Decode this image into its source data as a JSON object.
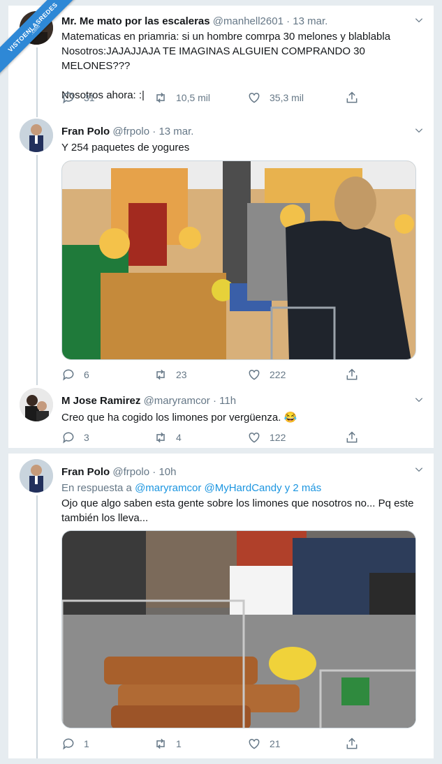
{
  "watermark": {
    "line1": "VISTOENLASREDES",
    "line2": ".com"
  },
  "tweets": [
    {
      "name": "Mr. Me mato por las escaleras",
      "handle": "@manhell2601",
      "dot": "·",
      "time": "13 mar.",
      "text": "Matematicas en priamria: si un hombre comrpa 30 melones y blablabla\nNosotros:JAJAJJAJA TE IMAGINAS ALGUIEN COMPRANDO 30 MELONES???\n\nNosotros ahora:  :|",
      "replies": "31",
      "retweets": "10,5 mil",
      "likes": "35,3 mil"
    },
    {
      "name": "Fran Polo",
      "handle": "@frpolo",
      "dot": "·",
      "time": "13 mar.",
      "text": "Y 254 paquetes de yogures",
      "replies": "6",
      "retweets": "23",
      "likes": "222"
    },
    {
      "name": "M Jose Ramirez",
      "handle": "@maryramcor",
      "dot": "·",
      "time": "11h",
      "text": "Creo que ha cogido los limones por vergüenza. 😂",
      "replies": "3",
      "retweets": "4",
      "likes": "122"
    },
    {
      "name": "Fran Polo",
      "handle": "@frpolo",
      "dot": "·",
      "time": "10h",
      "reply_prefix": "En respuesta a",
      "reply_users": "@maryramcor @MyHardCandy y 2 más",
      "text": "Ojo que algo saben esta gente sobre los limones que nosotros no... Pq este también los lleva...",
      "replies": "1",
      "retweets": "1",
      "likes": "21"
    }
  ],
  "colors": {
    "accent": "#1b95e0",
    "muted": "#657786",
    "ribbon": "#2e88d6"
  },
  "icons": [
    "reply-icon",
    "retweet-icon",
    "like-icon",
    "share-icon",
    "chevron-down-icon"
  ]
}
